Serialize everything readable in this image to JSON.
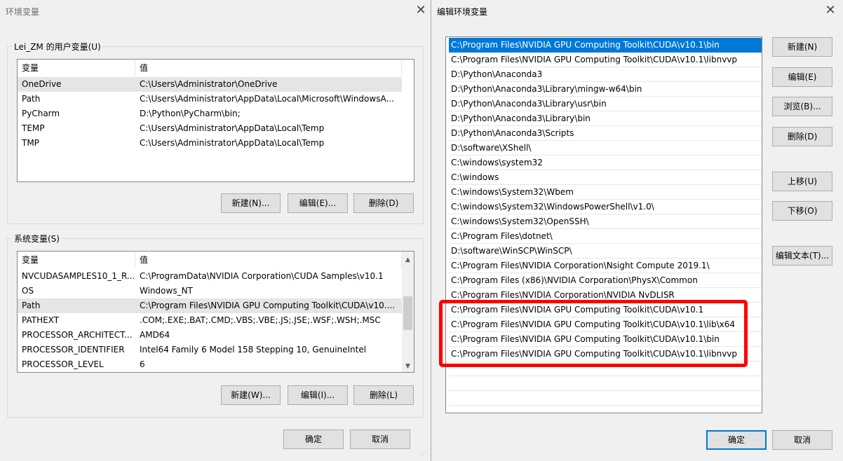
{
  "left_dialog": {
    "title": "环境变量",
    "user_group_label": "Lei_ZM 的用户变量(U)",
    "user_columns": [
      "变量",
      "值"
    ],
    "user_rows": [
      {
        "name": "OneDrive",
        "value": "C:\\Users\\Administrator\\OneDrive"
      },
      {
        "name": "Path",
        "value": "C:\\Users\\Administrator\\AppData\\Local\\Microsoft\\WindowsA..."
      },
      {
        "name": "PyCharm",
        "value": "D:\\Python\\PyCharm\\bin;"
      },
      {
        "name": "TEMP",
        "value": "C:\\Users\\Administrator\\AppData\\Local\\Temp"
      },
      {
        "name": "TMP",
        "value": "C:\\Users\\Administrator\\AppData\\Local\\Temp"
      }
    ],
    "user_buttons": {
      "new": "新建(N)...",
      "edit": "编辑(E)...",
      "delete": "删除(D)"
    },
    "system_group_label": "系统变量(S)",
    "system_columns": [
      "变量",
      "值"
    ],
    "system_rows": [
      {
        "name": "NVCUDASAMPLES10_1_R...",
        "value": "C:\\ProgramData\\NVIDIA Corporation\\CUDA Samples\\v10.1"
      },
      {
        "name": "OS",
        "value": "Windows_NT"
      },
      {
        "name": "Path",
        "value": "C:\\Program Files\\NVIDIA GPU Computing Toolkit\\CUDA\\v10...."
      },
      {
        "name": "PATHEXT",
        "value": ".COM;.EXE;.BAT;.CMD;.VBS;.VBE;.JS;.JSE;.WSF;.WSH;.MSC"
      },
      {
        "name": "PROCESSOR_ARCHITECT...",
        "value": "AMD64"
      },
      {
        "name": "PROCESSOR_IDENTIFIER",
        "value": "Intel64 Family 6 Model 158 Stepping 10, GenuineIntel"
      },
      {
        "name": "PROCESSOR_LEVEL",
        "value": "6"
      }
    ],
    "system_buttons": {
      "new": "新建(W)...",
      "edit": "编辑(I)...",
      "delete": "删除(L)"
    },
    "ok": "确定",
    "cancel": "取消"
  },
  "right_dialog": {
    "title": "编辑环境变量",
    "paths": [
      "C:\\Program Files\\NVIDIA GPU Computing Toolkit\\CUDA\\v10.1\\bin",
      "C:\\Program Files\\NVIDIA GPU Computing Toolkit\\CUDA\\v10.1\\libnvvp",
      "D:\\Python\\Anaconda3",
      "D:\\Python\\Anaconda3\\Library\\mingw-w64\\bin",
      "D:\\Python\\Anaconda3\\Library\\usr\\bin",
      "D:\\Python\\Anaconda3\\Library\\bin",
      "D:\\Python\\Anaconda3\\Scripts",
      "D:\\software\\XShell\\",
      "C:\\windows\\system32",
      "C:\\windows",
      "C:\\windows\\System32\\Wbem",
      "C:\\windows\\System32\\WindowsPowerShell\\v1.0\\",
      "C:\\windows\\System32\\OpenSSH\\",
      "C:\\Program Files\\dotnet\\",
      "D:\\software\\WinSCP\\WinSCP\\",
      "C:\\Program Files\\NVIDIA Corporation\\Nsight Compute 2019.1\\",
      "C:\\Program Files (x86)\\NVIDIA Corporation\\PhysX\\Common",
      "C:\\Program Files\\NVIDIA Corporation\\NVIDIA NvDLISR",
      "C:\\Program Files\\NVIDIA GPU Computing Toolkit\\CUDA\\v10.1",
      "C:\\Program Files\\NVIDIA GPU Computing Toolkit\\CUDA\\v10.1\\lib\\x64",
      "C:\\Program Files\\NVIDIA GPU Computing Toolkit\\CUDA\\v10.1\\bin",
      "C:\\Program Files\\NVIDIA GPU Computing Toolkit\\CUDA\\v10.1\\libnvvp"
    ],
    "buttons": {
      "new": "新建(N)",
      "edit": "编辑(E)",
      "browse": "浏览(B)...",
      "delete": "删除(D)",
      "move_up": "上移(U)",
      "move_down": "下移(O)",
      "edit_text": "编辑文本(T)..."
    },
    "ok": "确定",
    "cancel": "取消"
  },
  "colors": {
    "selection": "#0078d7",
    "annotation": "#ff0000"
  }
}
